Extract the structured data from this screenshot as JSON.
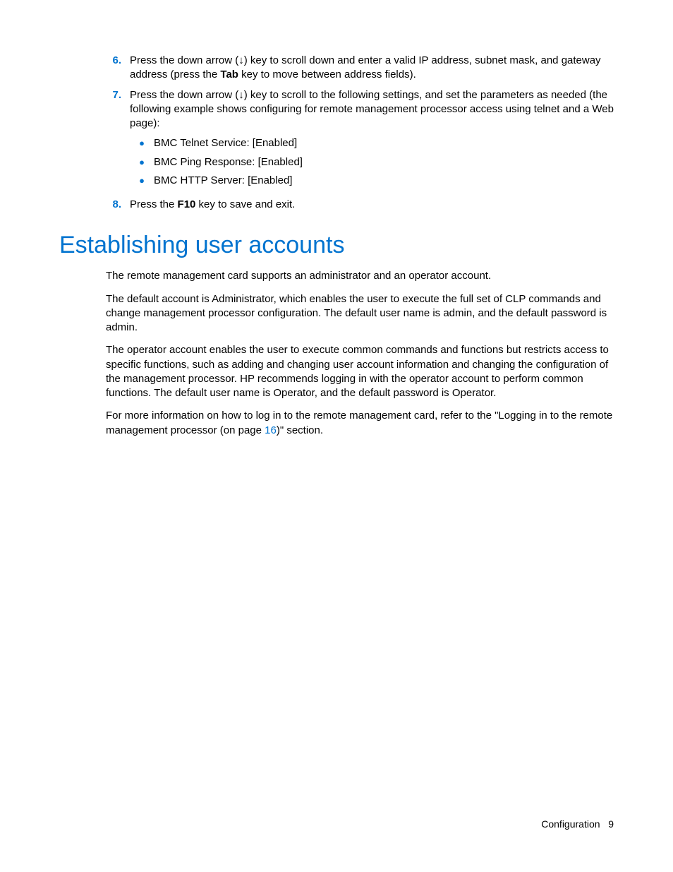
{
  "list": {
    "item6": {
      "num": "6.",
      "text_a": "Press the down arrow (↓) key to scroll down and enter a valid IP address, subnet mask, and gateway address (press the ",
      "bold_a": "Tab",
      "text_b": " key to move between address fields)."
    },
    "item7": {
      "num": "7.",
      "text": "Press the down arrow (↓) key to scroll to the following settings, and set the parameters as needed (the following example shows configuring for remote management processor access using telnet and a Web page):",
      "sub": [
        "BMC Telnet Service: [Enabled]",
        "BMC Ping Response: [Enabled]",
        "BMC HTTP Server: [Enabled]"
      ]
    },
    "item8": {
      "num": "8.",
      "text_a": "Press the ",
      "bold_a": "F10",
      "text_b": " key to save and exit."
    }
  },
  "heading": "Establishing user accounts",
  "paragraphs": {
    "p1": "The remote management card supports an administrator and an operator account.",
    "p2": "The default account is Administrator, which enables the user to execute the full set of CLP commands and change management processor configuration. The default user name is admin, and the default password is admin.",
    "p3": "The operator account enables the user to execute common commands and functions but restricts access to specific functions, such as adding and changing user account information and changing the configuration of the management processor. HP recommends logging in with the operator account to perform common functions. The default user name is Operator, and the default password is Operator.",
    "p4_a": "For more information on how to log in to the remote management card, refer to the \"Logging in to the remote management processor (on page ",
    "p4_link": "16",
    "p4_b": ")\" section."
  },
  "footer": {
    "section": "Configuration",
    "page": "9"
  }
}
